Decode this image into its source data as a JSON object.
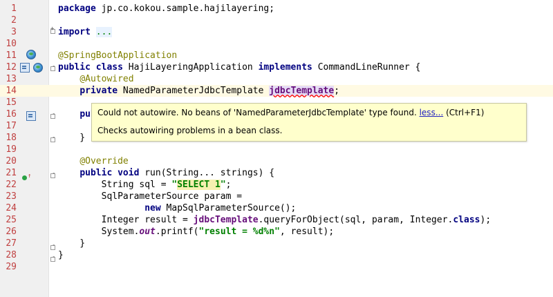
{
  "editor": {
    "lines": [
      {
        "n": "1",
        "code": [
          {
            "t": "package",
            "c": "kw"
          },
          {
            "t": " jp.co.kokou.sample.hajilayering;",
            "c": ""
          }
        ]
      },
      {
        "n": "2",
        "code": []
      },
      {
        "n": "3",
        "code": [
          {
            "t": "import",
            "c": "kw"
          },
          {
            "t": " ",
            "c": ""
          },
          {
            "t": "...",
            "c": "fold-text"
          }
        ]
      },
      {
        "n": "10",
        "code": []
      },
      {
        "n": "11",
        "code": [
          {
            "t": "@SpringBootApplication",
            "c": "ann"
          }
        ]
      },
      {
        "n": "12",
        "code": [
          {
            "t": "public class",
            "c": "kw"
          },
          {
            "t": " HajiLayeringApplication ",
            "c": ""
          },
          {
            "t": "implements",
            "c": "kw"
          },
          {
            "t": " CommandLineRunner {",
            "c": ""
          }
        ]
      },
      {
        "n": "13",
        "code": [
          {
            "t": "    ",
            "c": ""
          },
          {
            "t": "@Autowired",
            "c": "ann"
          }
        ]
      },
      {
        "n": "14",
        "code": [
          {
            "t": "    ",
            "c": ""
          },
          {
            "t": "private",
            "c": "kw"
          },
          {
            "t": " NamedParameterJdbcTemplate ",
            "c": ""
          },
          {
            "t": "jdbcTemplate",
            "c": "err"
          },
          {
            "t": ";",
            "c": ""
          }
        ]
      },
      {
        "n": "15",
        "code": []
      },
      {
        "n": "16",
        "code": [
          {
            "t": "    ",
            "c": ""
          },
          {
            "t": "pub",
            "c": "kw"
          }
        ]
      },
      {
        "n": "17",
        "code": []
      },
      {
        "n": "18",
        "code": [
          {
            "t": "    }",
            "c": ""
          }
        ]
      },
      {
        "n": "19",
        "code": []
      },
      {
        "n": "20",
        "code": [
          {
            "t": "    ",
            "c": ""
          },
          {
            "t": "@Override",
            "c": "ann"
          }
        ]
      },
      {
        "n": "21",
        "code": [
          {
            "t": "    ",
            "c": ""
          },
          {
            "t": "public void",
            "c": "kw"
          },
          {
            "t": " run(String... strings) {",
            "c": ""
          }
        ]
      },
      {
        "n": "22",
        "code": [
          {
            "t": "        String sql = ",
            "c": ""
          },
          {
            "t": "\"",
            "c": "str"
          },
          {
            "t": "SELECT 1",
            "c": "str hl-str"
          },
          {
            "t": "\"",
            "c": "str"
          },
          {
            "t": ";",
            "c": ""
          }
        ]
      },
      {
        "n": "23",
        "code": [
          {
            "t": "        SqlParameterSource param =",
            "c": ""
          }
        ]
      },
      {
        "n": "24",
        "code": [
          {
            "t": "                ",
            "c": ""
          },
          {
            "t": "new",
            "c": "kw"
          },
          {
            "t": " MapSqlParameterSource();",
            "c": ""
          }
        ]
      },
      {
        "n": "25",
        "code": [
          {
            "t": "        Integer result = ",
            "c": ""
          },
          {
            "t": "jdbcTemplate",
            "c": "fld"
          },
          {
            "t": ".queryForObject(sql, param, Integer.",
            "c": ""
          },
          {
            "t": "class",
            "c": "kw"
          },
          {
            "t": ");",
            "c": ""
          }
        ]
      },
      {
        "n": "26",
        "code": [
          {
            "t": "        System.",
            "c": ""
          },
          {
            "t": "out",
            "c": "ital"
          },
          {
            "t": ".printf(",
            "c": ""
          },
          {
            "t": "\"result = %d%n\"",
            "c": "str"
          },
          {
            "t": ", result);",
            "c": ""
          }
        ]
      },
      {
        "n": "27",
        "code": [
          {
            "t": "    }",
            "c": ""
          }
        ]
      },
      {
        "n": "28",
        "code": [
          {
            "t": "}",
            "c": ""
          }
        ]
      },
      {
        "n": "29",
        "code": []
      }
    ],
    "current_line": "14"
  },
  "tooltip": {
    "message": "Could not autowire. No beans of 'NamedParameterJdbcTemplate' type found.",
    "link_text": "less...",
    "shortcut": "(Ctrl+F1)",
    "description": "Checks autowiring problems in a bean class."
  },
  "icons": {
    "line_11": "spring-bean-icon",
    "line_12": [
      "implemented-interface-icon",
      "spring-bean-icon"
    ],
    "line_16": "implemented-interface-icon",
    "line_21": "override-method-icon"
  }
}
